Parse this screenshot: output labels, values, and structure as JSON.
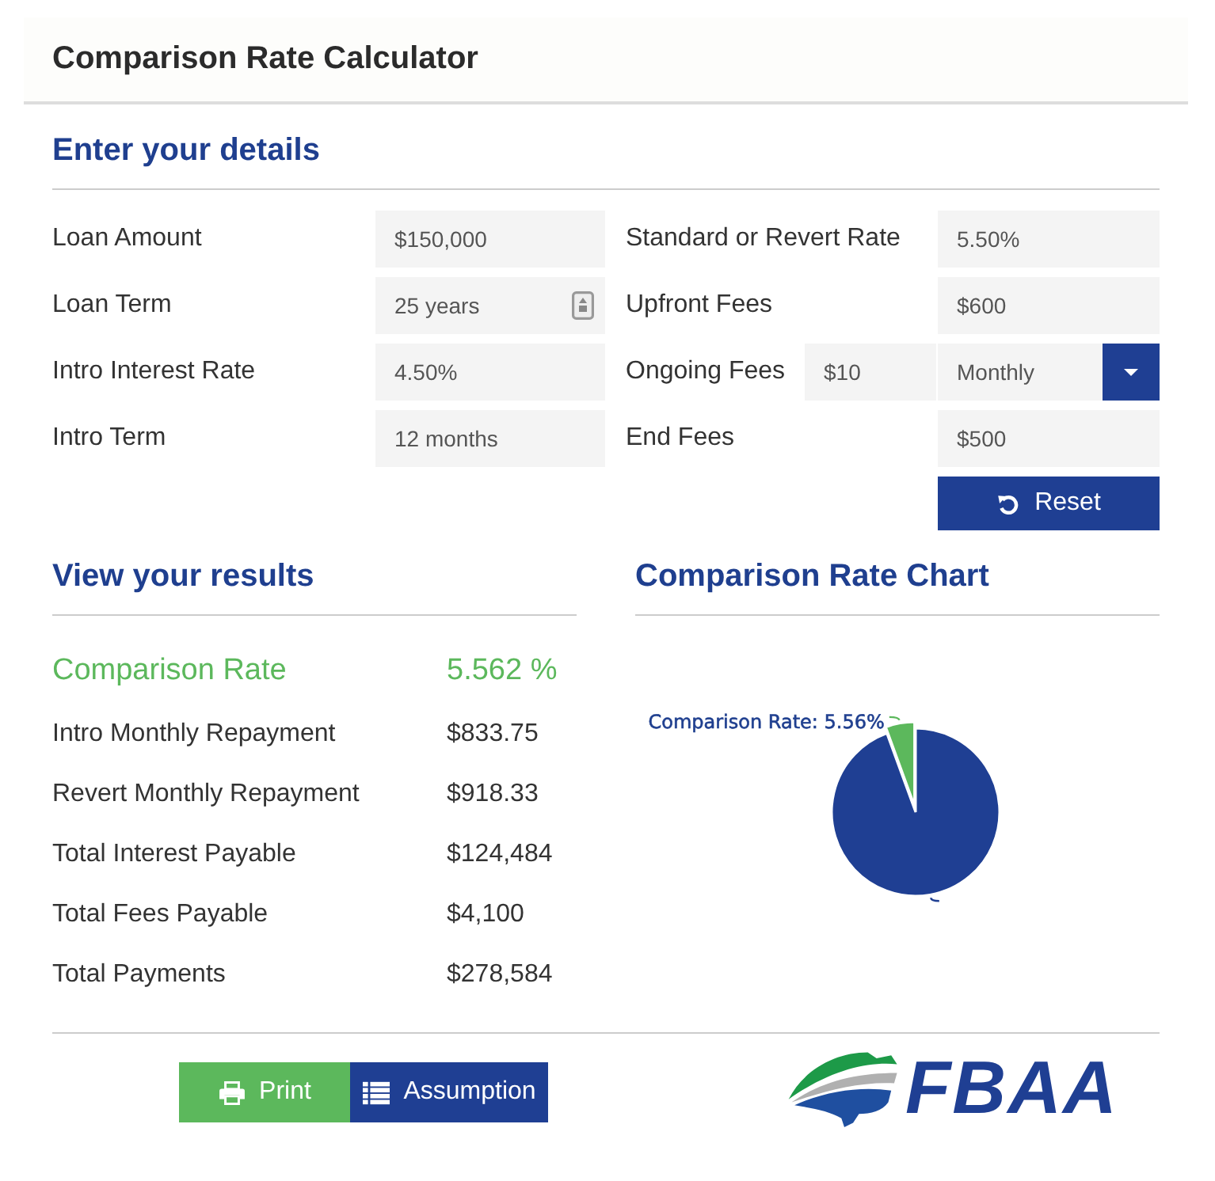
{
  "title": "Comparison Rate Calculator",
  "details": {
    "heading": "Enter your details",
    "left_fields": [
      {
        "label": "Loan Amount",
        "value": "$150,000",
        "kind": "text"
      },
      {
        "label": "Loan Term",
        "value": "25 years",
        "kind": "stepper"
      },
      {
        "label": "Intro Interest Rate",
        "value": "4.50%",
        "kind": "text"
      },
      {
        "label": "Intro Term",
        "value": "12 months",
        "kind": "text"
      }
    ],
    "right_fields": [
      {
        "label": "Standard or Revert Rate",
        "value": "5.50%",
        "kind": "text"
      },
      {
        "label": "Upfront Fees",
        "value": "$600",
        "kind": "text"
      },
      {
        "label": "Ongoing Fees",
        "value": "$10",
        "kind": "amount_select",
        "select": "Monthly"
      },
      {
        "label": "End Fees",
        "value": "$500",
        "kind": "text"
      }
    ],
    "reset_button": "Reset"
  },
  "results": {
    "heading": "View your results",
    "rows": [
      {
        "label": "Comparison Rate",
        "value": "5.562 %",
        "kind": "highlight"
      },
      {
        "label": "Intro Monthly Repayment",
        "value": "$833.75",
        "kind": "plain"
      },
      {
        "label": "Revert Monthly Repayment",
        "value": "$918.33",
        "kind": "plain"
      },
      {
        "label": "Total Interest Payable",
        "value": "$124,484",
        "kind": "plain"
      },
      {
        "label": "Total Fees Payable",
        "value": "$4,100",
        "kind": "plain"
      },
      {
        "label": "Total Payments",
        "value": "$278,584",
        "kind": "plain"
      }
    ]
  },
  "chart": {
    "heading": "Comparison Rate Chart",
    "chart_data": {
      "type": "pie",
      "values": [
        5.56,
        94.44
      ],
      "colors": [
        "#5cb85c",
        "#1f3f93"
      ],
      "value_labels": [
        "Comparison Rate: 5.56%",
        null
      ]
    }
  },
  "footer": {
    "buttons": [
      {
        "label": "Print",
        "kind": "print"
      },
      {
        "label": "Assumption",
        "kind": "assumption"
      }
    ],
    "logo": "FBAA"
  }
}
